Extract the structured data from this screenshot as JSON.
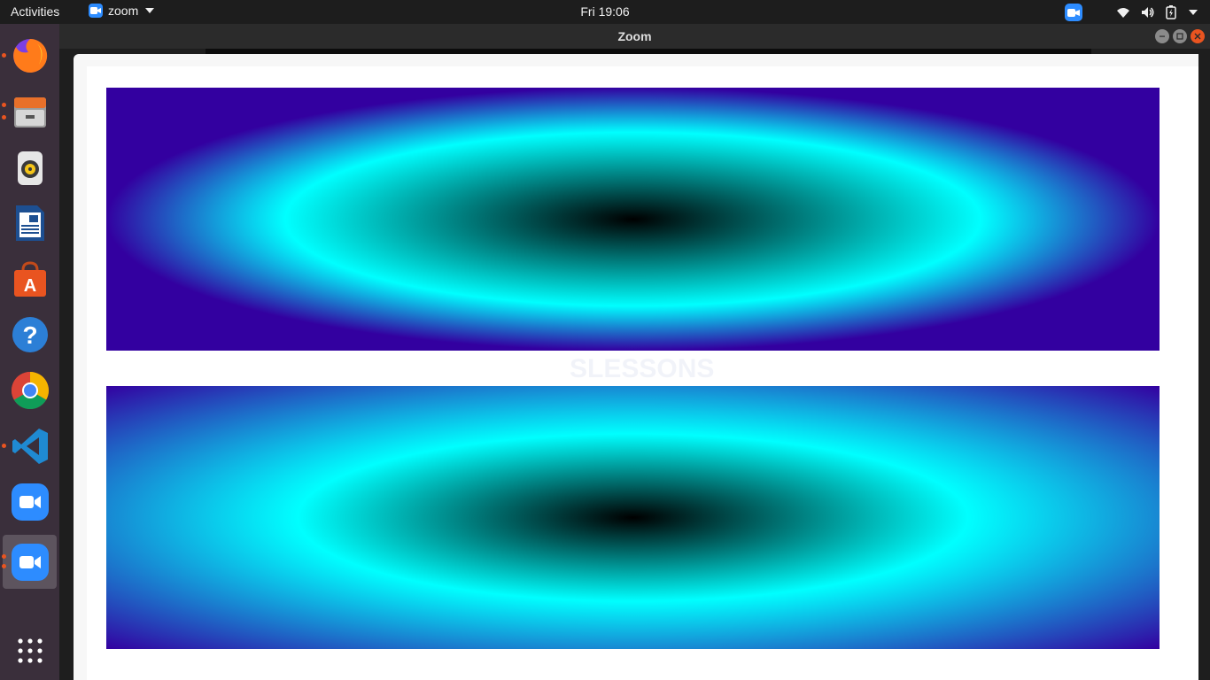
{
  "topbar": {
    "activities": "Activities",
    "app_menu_label": "zoom",
    "clock": "Fri 19:06"
  },
  "window": {
    "title": "Zoom"
  },
  "dock": {
    "items": [
      {
        "name": "firefox",
        "running": true
      },
      {
        "name": "files",
        "running": true
      },
      {
        "name": "rhythmbox",
        "running": false
      },
      {
        "name": "libreoffice-writer",
        "running": false
      },
      {
        "name": "ubuntu-software",
        "running": false
      },
      {
        "name": "help",
        "running": false
      },
      {
        "name": "chrome",
        "running": false
      },
      {
        "name": "vscode",
        "running": true
      },
      {
        "name": "zoom",
        "running": false
      },
      {
        "name": "zoom",
        "running": true,
        "active": true
      }
    ],
    "show_apps": "show-applications"
  },
  "content": {
    "gradient_colors": [
      "#000000",
      "#00ffff",
      "#3300a0"
    ],
    "watermark": "SLESSONS"
  }
}
